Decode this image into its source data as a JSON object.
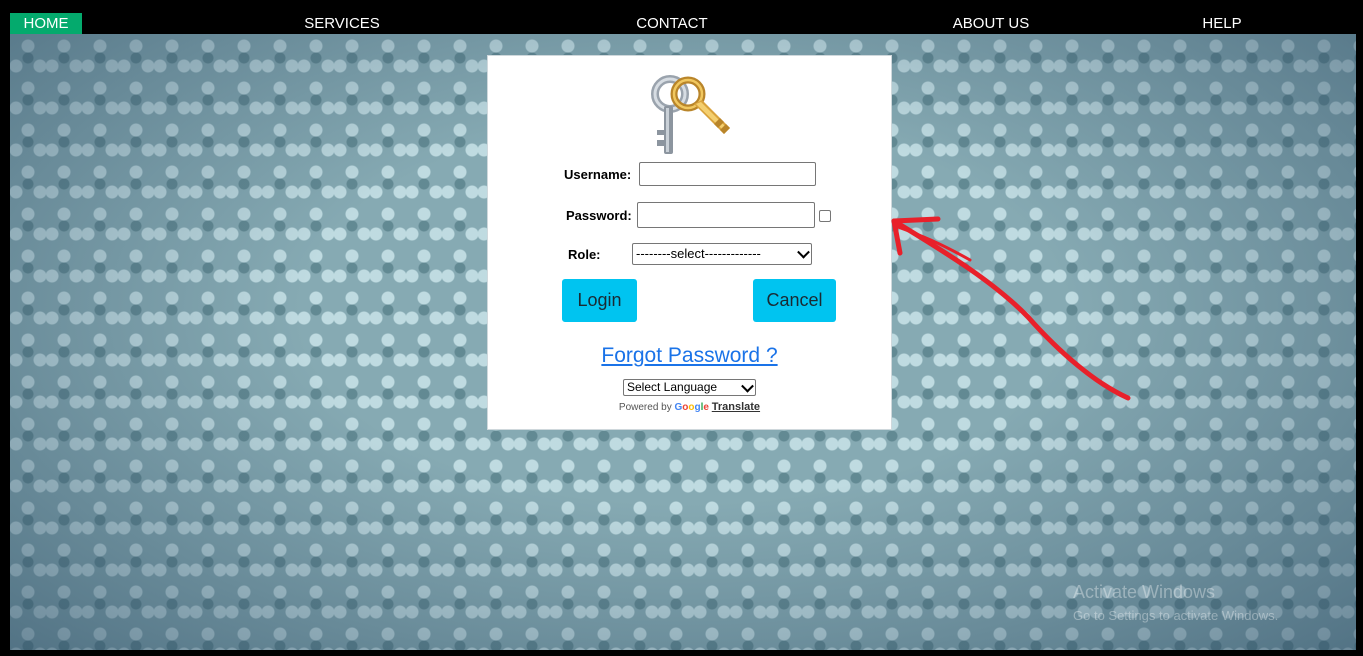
{
  "nav": {
    "items": [
      {
        "label": "HOME",
        "active": true
      },
      {
        "label": "SERVICES",
        "active": false
      },
      {
        "label": "CONTACT",
        "active": false
      },
      {
        "label": "ABOUT US",
        "active": false
      },
      {
        "label": "HELP",
        "active": false
      }
    ],
    "active_color": "#04aa6d"
  },
  "login": {
    "icon": "keys-icon",
    "username_label": "Username:",
    "username_value": "",
    "password_label": "Password:",
    "password_value": "",
    "show_password_checked": false,
    "role_label": "Role:",
    "role_selected": "--------select-------------",
    "login_label": "Login",
    "cancel_label": "Cancel",
    "button_color": "#00c4f0",
    "forgot_label": "Forgot Password ?",
    "forgot_color": "#1a73e8"
  },
  "translate": {
    "select_label": "Select Language",
    "powered_by": "Powered by",
    "google": "Google",
    "translate": "Translate"
  },
  "watermark": {
    "title": "Activate Windows",
    "subtitle": "Go to Settings to activate Windows."
  },
  "annotation": {
    "arrow_color": "#e8202a"
  }
}
